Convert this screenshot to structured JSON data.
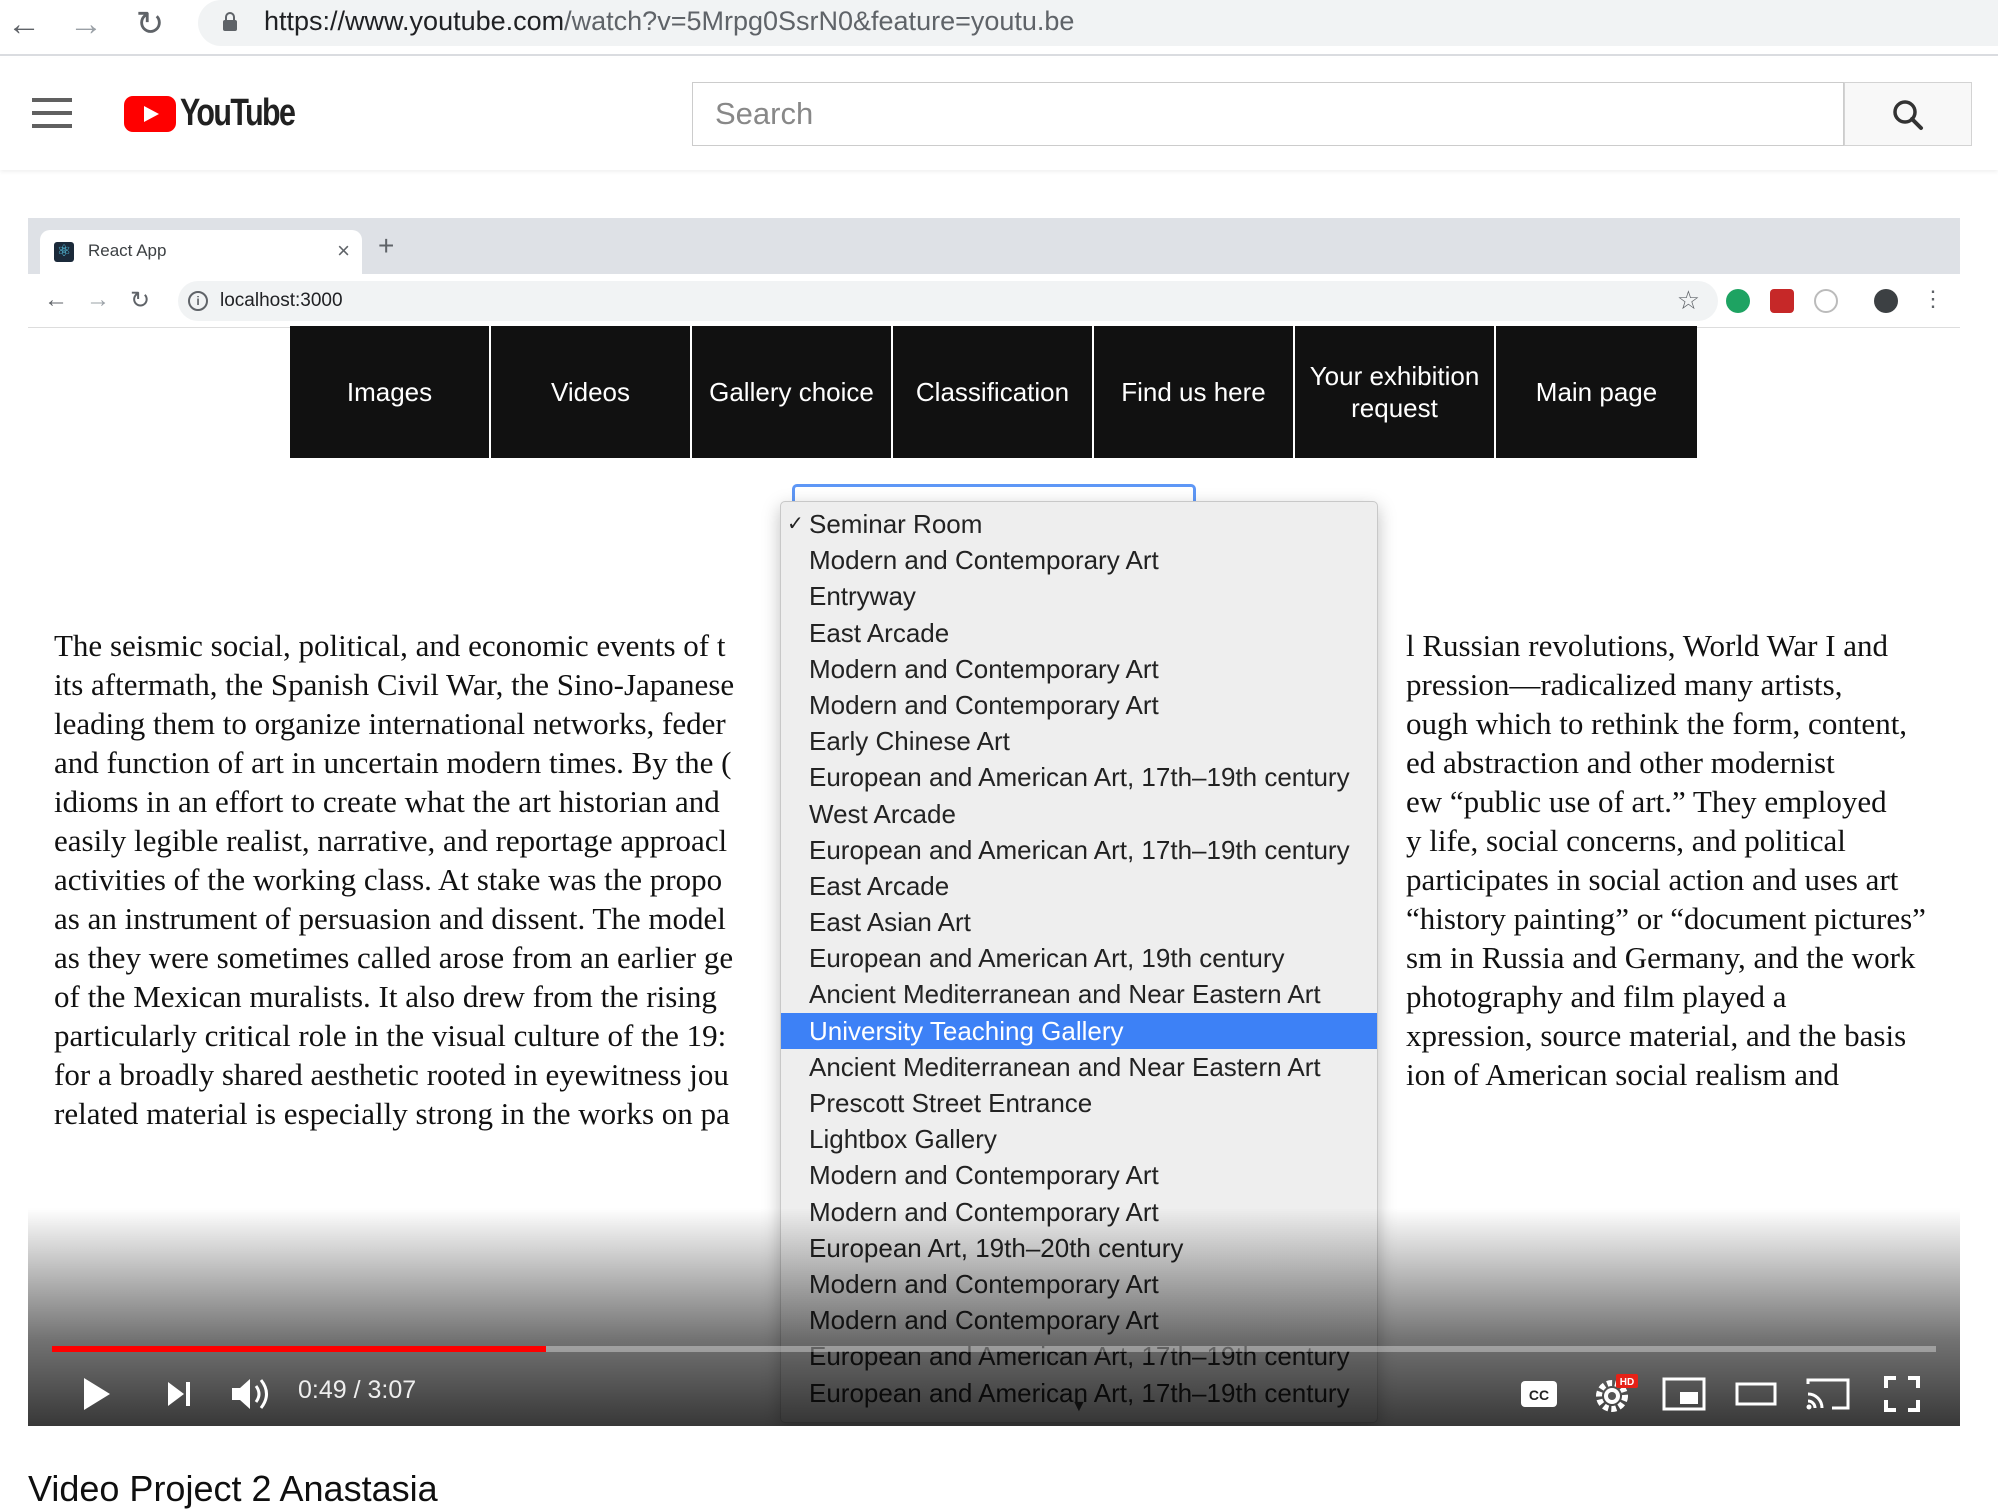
{
  "browser": {
    "url_host": "https://www.youtube.com",
    "url_path": "/watch?v=5Mrpg0SsrN0&feature=youtu.be"
  },
  "youtube": {
    "logo_text": "YouTube",
    "search_placeholder": "Search"
  },
  "inner_browser": {
    "tab_title": "React App",
    "url": "localhost:3000"
  },
  "nav": {
    "items": [
      "Images",
      "Videos",
      "Gallery choice",
      "Classification",
      "Find us here",
      "Your exhibition request",
      "Main page"
    ]
  },
  "dropdown": {
    "selected": "Seminar Room",
    "highlighted": "University Teaching Gallery",
    "options": [
      "Seminar Room",
      "Modern and Contemporary Art",
      "Entryway",
      "East Arcade",
      "Modern and Contemporary Art",
      "Modern and Contemporary Art",
      "Early Chinese Art",
      "European and American Art, 17th–19th century",
      "West Arcade",
      "European and American Art, 17th–19th century",
      "East Arcade",
      "East Asian Art",
      "European and American Art, 19th century",
      "Ancient Mediterranean and Near Eastern Art",
      "University Teaching Gallery",
      "Ancient Mediterranean and Near Eastern Art",
      "Prescott Street Entrance",
      "Lightbox Gallery",
      "Modern and Contemporary Art",
      "Modern and Contemporary Art",
      "European Art, 19th–20th century",
      "Modern and Contemporary Art",
      "Modern and Contemporary Art",
      "European and American Art, 17th–19th century",
      "European and American Art, 17th–19th century"
    ]
  },
  "body_text": {
    "lines": [
      "The seismic social, political, and economic events of t",
      "its aftermath, the Spanish Civil War, the Sino-Japanese",
      "leading them to organize international networks, feder",
      "and function of art in uncertain modern times. By the (",
      "idioms in an effort to create what the art historian and",
      "easily legible realist, narrative, and reportage approacl",
      "activities of the working class. At stake was the propo",
      "as an instrument of persuasion and dissent. The model",
      "as they were sometimes called arose from an earlier ge",
      "of the Mexican muralists. It also drew from the rising",
      "particularly critical role in the visual culture of the 19:",
      "for a broadly shared aesthetic rooted in eyewitness jou",
      "related material is especially strong in the works on pa"
    ],
    "right_lines": [
      "l Russian revolutions, World War I and",
      "pression—radicalized many artists,",
      "ough which to rethink the form, content,",
      "ed abstraction and other modernist",
      "ew “public use of art.” They employed",
      "y life, social concerns, and political",
      "participates in social action and uses art",
      "“history painting” or “document pictures”",
      "sm in Russia and Germany, and the work",
      "photography and film played a",
      "xpression, source material, and the basis",
      "ion of American social realism and",
      ""
    ]
  },
  "player": {
    "current_time": "0:49",
    "duration": "3:07",
    "time_display": "0:49 / 3:07",
    "progress_fraction": 0.262,
    "hd_badge": "HD",
    "cc_label": "CC"
  },
  "video_title": "Video Project 2 Anastasia",
  "colors": {
    "accent_red": "#ff0000",
    "highlight_blue": "#3d81f6",
    "nav_bg": "#111111"
  }
}
